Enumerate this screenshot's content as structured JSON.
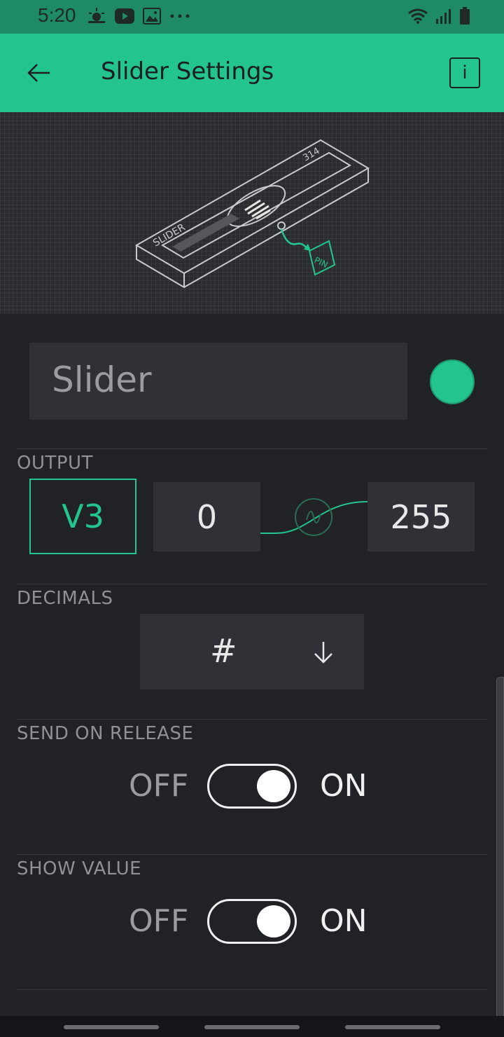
{
  "status_bar": {
    "time": "5:20",
    "left_icons": [
      "weather-icon",
      "youtube-icon",
      "gallery-icon",
      "more-dots-icon"
    ],
    "right_icons": [
      "wifi-icon",
      "signal-icon",
      "battery-icon"
    ]
  },
  "app_bar": {
    "title": "Slider Settings",
    "info_label": "i"
  },
  "hero": {
    "slider_label": "SLIDER",
    "value_label": "314",
    "pin_label": "PIN"
  },
  "widget": {
    "name": "Slider",
    "color": "#23c48e"
  },
  "output": {
    "label": "OUTPUT",
    "pin": "V3",
    "min": "0",
    "max": "255"
  },
  "decimals": {
    "label": "DECIMALS",
    "value": "#"
  },
  "send_on_release": {
    "label": "SEND ON RELEASE",
    "off_label": "OFF",
    "on_label": "ON",
    "state": "on"
  },
  "show_value": {
    "label": "SHOW VALUE",
    "off_label": "OFF",
    "on_label": "ON",
    "state": "on"
  },
  "colors": {
    "accent": "#23c48e",
    "background": "#212226",
    "field": "#2f3136"
  }
}
